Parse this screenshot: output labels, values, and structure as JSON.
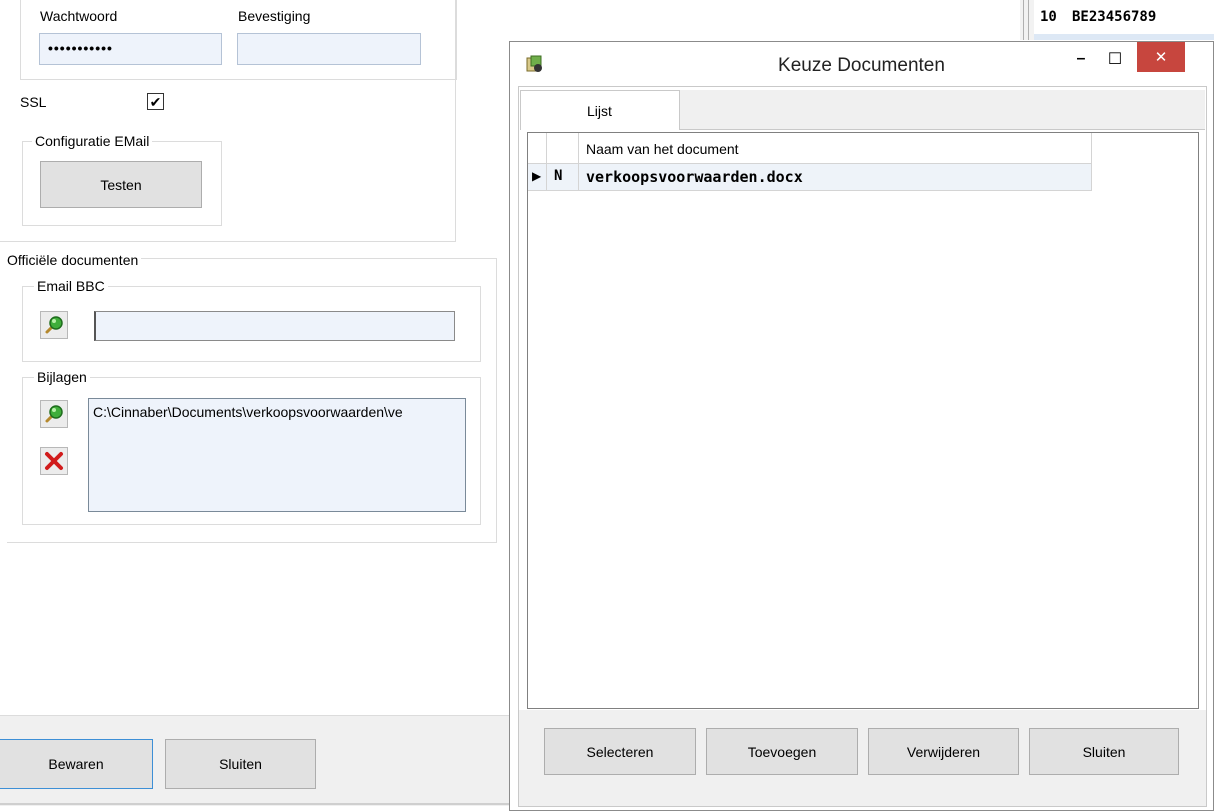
{
  "credentials": {
    "password_label": "Wachtwoord",
    "password_value": "•••••••••••",
    "confirm_label": "Bevestiging",
    "confirm_value": ""
  },
  "ssl": {
    "label": "SSL",
    "checked": true,
    "check_glyph": "✔"
  },
  "config_email": {
    "legend": "Configuratie EMail",
    "test_button": "Testen"
  },
  "official_docs": {
    "legend": "Officiële documenten",
    "email_bbc": {
      "legend": "Email BBC",
      "value": "",
      "search_icon": "search-icon"
    },
    "attachments": {
      "legend": "Bijlagen",
      "path": "C:\\Cinnaber\\Documents\\verkoopsvoorwaarden\\ve",
      "search_icon": "search-icon",
      "delete_icon": "delete-icon"
    }
  },
  "footer": {
    "save_button": "Bewaren",
    "close_button": "Sluiten"
  },
  "background_grid": {
    "row_number": "10",
    "row_value": "BE23456789"
  },
  "dialog": {
    "title": "Keuze Documenten",
    "app_icon": "app-icon",
    "minimize_glyph": "–",
    "maximize_glyph": "☐",
    "close_glyph": "✕",
    "tab_label": "Lijst",
    "table": {
      "column_header": "Naam van het document",
      "rows": [
        {
          "indicator": "▶",
          "flag": "N",
          "name": "verkoopsvoorwaarden.docx"
        }
      ]
    },
    "buttons": {
      "select": "Selecteren",
      "add": "Toevoegen",
      "delete": "Verwijderen",
      "close": "Sluiten"
    }
  },
  "colors": {
    "close_red": "#c7463e",
    "input_bg": "#eef3fb",
    "accent_border": "#3d8fd6"
  }
}
